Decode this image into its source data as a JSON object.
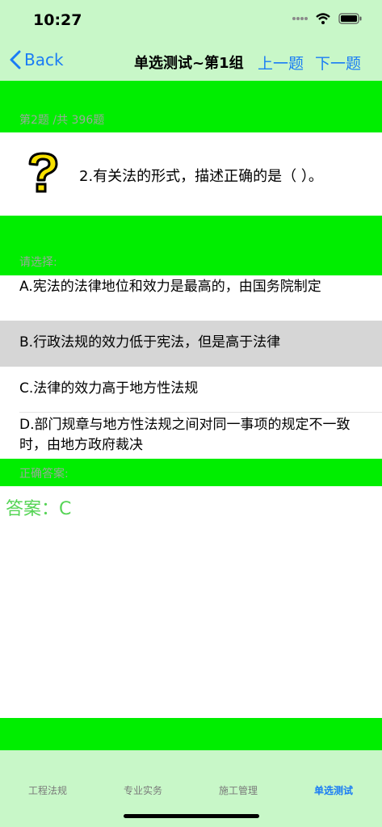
{
  "status_bar": {
    "time": "10:27"
  },
  "nav": {
    "back_label": "Back",
    "title": "单选测试~第1组",
    "prev_label": "上一题",
    "next_label": "下一题"
  },
  "question": {
    "counter": "第2题 /共 396题",
    "text": "2.有关法的形式，描述正确的是（    ）。"
  },
  "options_label": "请选择:",
  "options": [
    {
      "text": "A.宪法的法律地位和效力是最高的，由国务院制定",
      "selected": false
    },
    {
      "text": "B.行政法规的效力低于宪法，但是高于法律",
      "selected": true
    },
    {
      "text": "C.法律的效力高于地方性法规",
      "selected": false
    },
    {
      "text": "D.部门规章与地方性法规之间对同一事项的规定不一致时，由地方政府裁决",
      "selected": false
    }
  ],
  "answer": {
    "label": "正确答案:",
    "text": "答案：C"
  },
  "tabs": [
    {
      "label": "工程法规",
      "active": false
    },
    {
      "label": "专业实务",
      "active": false
    },
    {
      "label": "施工管理",
      "active": false
    },
    {
      "label": "单选测试",
      "active": true
    }
  ],
  "colors": {
    "bar_background": "#c8f7c8",
    "highlight_green": "#00ee00",
    "accent_blue": "#1a7cf5",
    "answer_green": "#55d455",
    "selected_option": "#d6d6d6"
  }
}
